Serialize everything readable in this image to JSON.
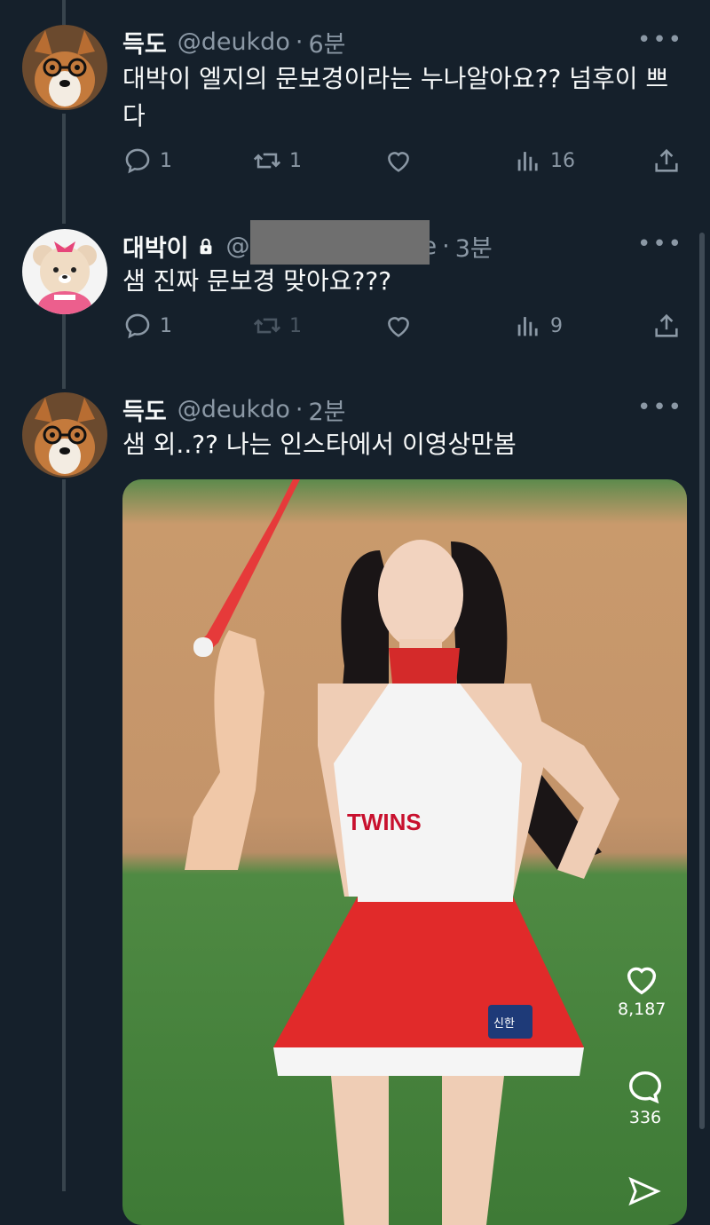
{
  "tweets": [
    {
      "name": "득도",
      "handle": "@deukdo",
      "separator": "·",
      "time": "6분",
      "text": "대박이 엘지의 문보경이라는 누나알아요?? 넘후이 쁘다",
      "stats": {
        "replies": "1",
        "retweets": "1",
        "views": "16"
      },
      "more": "•••",
      "avatar_icon": "corgi-with-glasses-avatar"
    },
    {
      "name": "대박이",
      "handle": "@",
      "handle_tail": "e",
      "separator": "·",
      "time": "3분",
      "text": "샘 진짜 문보경 맞아요???",
      "stats": {
        "replies": "1",
        "retweets": "1",
        "views": "9"
      },
      "more": "•••",
      "protected": true,
      "avatar_icon": "teddy-bear-tigers-avatar"
    },
    {
      "name": "득도",
      "handle": "@deukdo",
      "separator": "·",
      "time": "2분",
      "text": "샘 외..?? 나는 인스타에서 이영상만봄",
      "more": "•••",
      "avatar_icon": "corgi-with-glasses-avatar",
      "media": {
        "jersey_text": "TWINS",
        "badge_text": "신한",
        "overlay": {
          "likes": "8,187",
          "comments": "336"
        }
      }
    }
  ],
  "colors": {
    "background": "#15202b",
    "text": "#f7f9f9",
    "secondary": "#8b98a5",
    "thread_line": "#38444d"
  }
}
